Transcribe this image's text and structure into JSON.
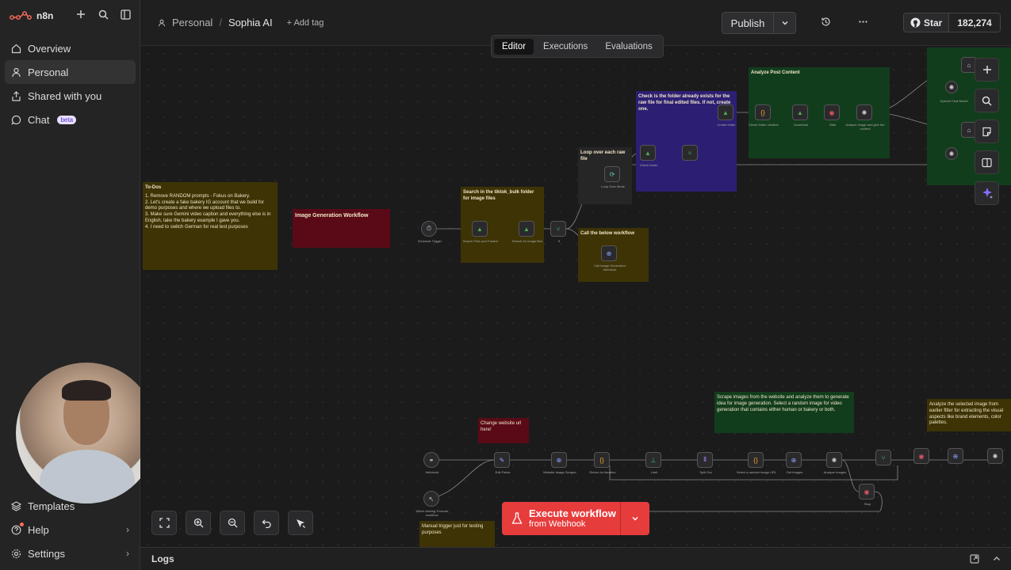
{
  "brand": {
    "name": "n8n"
  },
  "sidebar": {
    "items": [
      {
        "label": "Overview",
        "icon": "home-icon"
      },
      {
        "label": "Personal",
        "icon": "user-icon",
        "active": true
      },
      {
        "label": "Shared with you",
        "icon": "share-icon"
      },
      {
        "label": "Chat",
        "icon": "chat-icon",
        "badge": "beta"
      }
    ],
    "bottom": [
      {
        "label": "Templates",
        "icon": "templates-icon"
      },
      {
        "label": "Help",
        "icon": "help-icon"
      },
      {
        "label": "Settings",
        "icon": "settings-icon"
      }
    ]
  },
  "header": {
    "breadcrumb_project": "Personal",
    "breadcrumb_sep": "/",
    "workflow_name": "Sophia AI",
    "add_tag": "+ Add tag",
    "publish": "Publish",
    "github_star": "Star",
    "github_count": "182,274"
  },
  "tabs": [
    {
      "label": "Editor",
      "active": true
    },
    {
      "label": "Executions"
    },
    {
      "label": "Evaluations"
    }
  ],
  "canvas": {
    "stickies": {
      "todos_title": "To-Dos",
      "todos_items": [
        "1. Remove RANDOM prompts - Fokus on Bakery.",
        "2. Let's create a fake bakery IG account that we build for demo purposes and where we upload files to.",
        "3. Make sure Gemini video caption and everything else is in English, take the bakery example I gave you.",
        "4. I need to switch German for real test purposes"
      ],
      "image_gen": "Image Generation Workflow",
      "search_tiktok": "Search in the tiktok_bulk folder for image files",
      "loop_raw": "Loop over each raw file",
      "call_below": "Call the below workflow",
      "check_folder": "Check is the folder already exists for the raw file for final edited files. If not, create one.",
      "analyze_post": "Analyze Post Content",
      "scrape_images": "Scrape images from the website and analyze them to generate idea for image generation. Select a random image for video generation that contains either human or bakery or both.",
      "analyze_selected": "Analyze the selected image from earlier filter for extracting the visual aspects like brand elements, color palettes.",
      "change_url": "Change website url here!",
      "manual_trigger": "Manual trigger just for testing purposes"
    },
    "nodes": {
      "schedule": "Schedule Trigger",
      "search_files": "Search Files and Folders",
      "search_images": "Search for image files",
      "if": "If",
      "loop": "Loop Over Items",
      "call_webhook": "Call Image Generation Webhook",
      "check_folder": "Check folder",
      "create_folder": "Create folder",
      "folder_check": "Check folder creation",
      "download": "Download",
      "wait": "Wait",
      "analyze_image": "Analyze image and give the content",
      "openai_chat": "OpenAI Chat Model",
      "webhook": "Webhook",
      "edit_fields": "Edit Fields",
      "scrape": "Website Image Scraper",
      "return_iteration": "Return for iteration",
      "limit": "Limit",
      "split_out": "Split Out",
      "select_random": "Select a random image URL",
      "get_images": "Get Images",
      "analyze_images": "Analyze Images",
      "stop": "Stop",
      "manual": "When clicking 'Execute workflow'"
    }
  },
  "execute": {
    "title": "Execute workflow",
    "subtitle": "from Webhook"
  },
  "logs": {
    "label": "Logs"
  },
  "colors": {
    "accent": "#e73c3c",
    "sticky_yellow": "#3d3305",
    "sticky_red": "#5a0a16",
    "sticky_purple": "#2c1f73",
    "sticky_green": "#123d1c"
  }
}
